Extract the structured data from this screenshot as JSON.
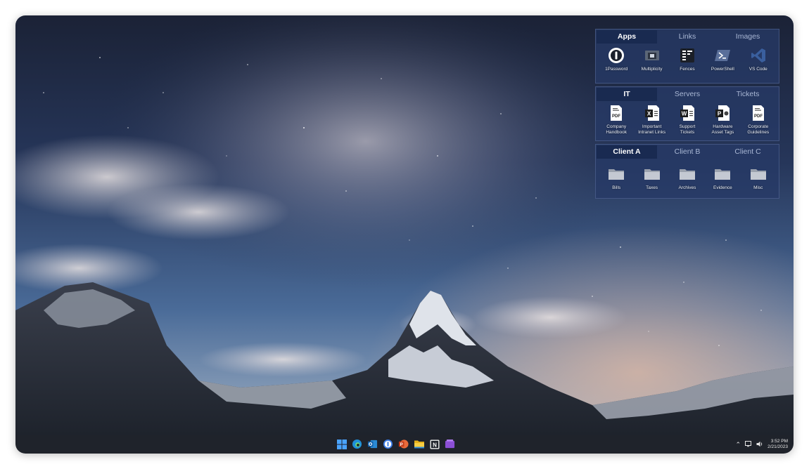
{
  "fences": [
    {
      "tabs": [
        "Apps",
        "Links",
        "Images"
      ],
      "active_tab": 0,
      "items": [
        {
          "label": "1Password",
          "icon": "1password-icon"
        },
        {
          "label": "Multiplicity",
          "icon": "multiplicity-icon"
        },
        {
          "label": "Fences",
          "icon": "fences-icon"
        },
        {
          "label": "PowerShell",
          "icon": "powershell-icon"
        },
        {
          "label": "VS Code",
          "icon": "vscode-icon"
        }
      ]
    },
    {
      "tabs": [
        "IT",
        "Servers",
        "Tickets"
      ],
      "active_tab": 0,
      "items": [
        {
          "label": "Company\nHandbook",
          "icon": "pdf-file-icon"
        },
        {
          "label": "Important\nIntranet Links",
          "icon": "excel-file-icon"
        },
        {
          "label": "Support\nTickets",
          "icon": "word-file-icon"
        },
        {
          "label": "Hardware\nAsset Tags",
          "icon": "powerpoint-file-icon"
        },
        {
          "label": "Corporate\nGuidelines",
          "icon": "pdf-file-icon"
        }
      ]
    },
    {
      "tabs": [
        "Client A",
        "Client B",
        "Client C"
      ],
      "active_tab": 0,
      "items": [
        {
          "label": "Bills",
          "icon": "folder-icon"
        },
        {
          "label": "Taxes",
          "icon": "folder-icon"
        },
        {
          "label": "Archives",
          "icon": "folder-icon"
        },
        {
          "label": "Evidence",
          "icon": "folder-icon"
        },
        {
          "label": "Misc",
          "icon": "folder-icon"
        }
      ]
    }
  ],
  "taskbar": {
    "apps": [
      "start-icon",
      "edge-icon",
      "outlook-icon",
      "1password-icon",
      "powerpoint-icon",
      "file-explorer-icon",
      "notion-icon",
      "onenote-icon"
    ]
  },
  "tray": {
    "time": "3:52 PM",
    "date": "2/21/2023"
  },
  "colors": {
    "fence_bg": "#263a66",
    "fence_active_tab": "#18284e",
    "taskbar": "#1f232b"
  }
}
